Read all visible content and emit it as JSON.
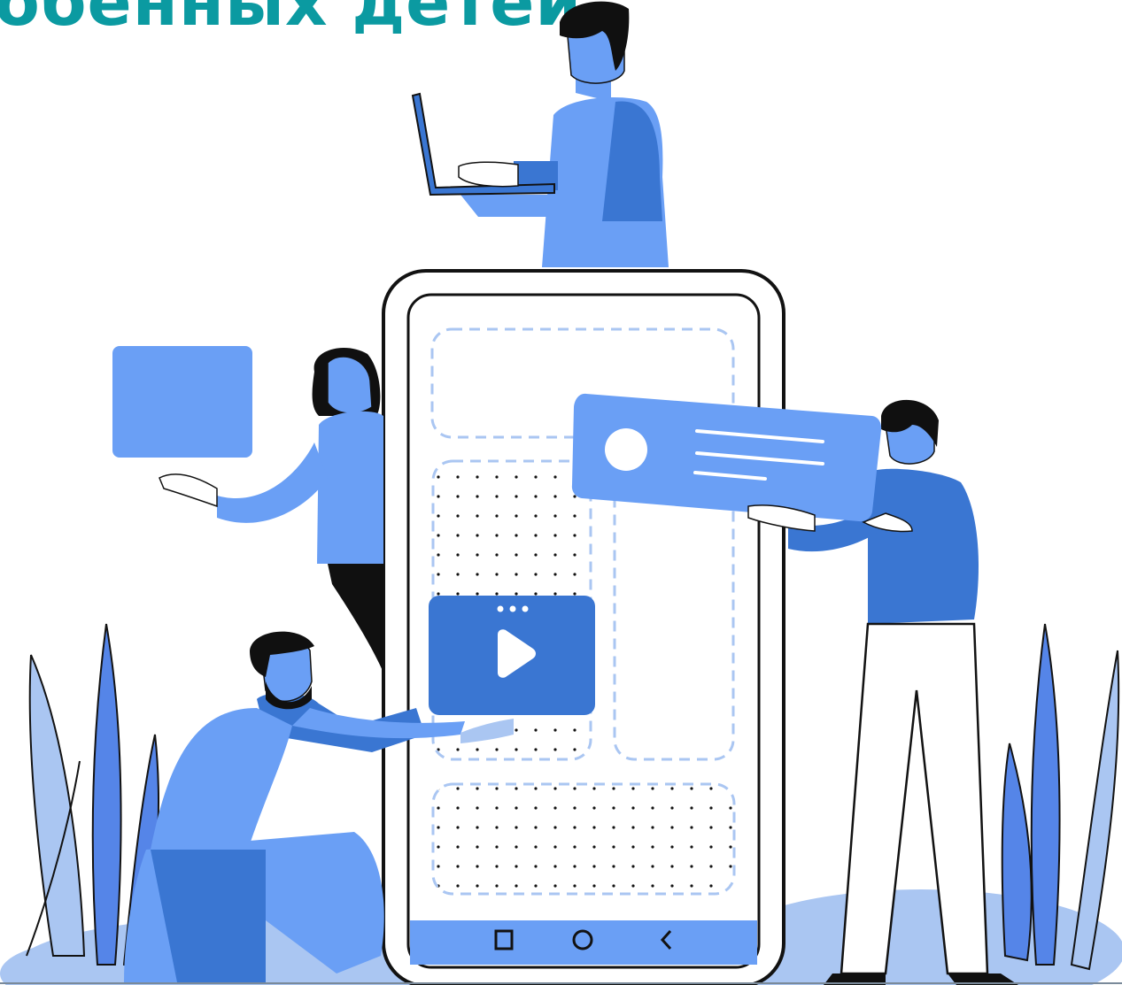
{
  "heading": {
    "text": "обенных детей"
  },
  "colors": {
    "heading": "#0b9aa1",
    "blue_light": "#6a9ff5",
    "blue_mid": "#5585e8",
    "blue_dark": "#3a76d2",
    "blue_pale": "#aac6f2",
    "outline": "#121212",
    "skin": "#ffffff",
    "hair": "#101010"
  },
  "illustration": {
    "subject": "team-building-mobile-app",
    "phone": {
      "nav_icons": [
        "square-icon",
        "circle-icon",
        "back-chevron-icon"
      ],
      "content_blocks": [
        "dashed-placeholder",
        "dotted-card",
        "video-card",
        "dashed-column",
        "dotted-card"
      ]
    },
    "cards": [
      "blue-square-card",
      "profile-card",
      "video-play-card"
    ],
    "people": [
      "man-with-laptop",
      "woman-holding-card",
      "bearded-man-kneeling",
      "man-holding-profile-card"
    ]
  }
}
